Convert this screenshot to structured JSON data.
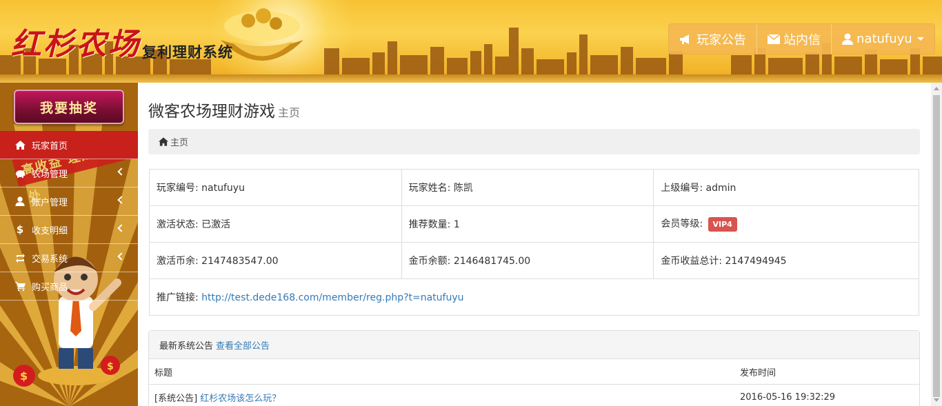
{
  "header": {
    "logo_title": "红杉农场",
    "logo_subtitle": "复利理财系统",
    "nav": [
      {
        "label": "玩家公告",
        "icon": "bullhorn-icon"
      },
      {
        "label": "站内信",
        "icon": "envelope-icon"
      },
      {
        "label": "natufuyu",
        "icon": "user-icon"
      }
    ]
  },
  "sidebar": {
    "lottery_button": "我要抽奖",
    "items": [
      {
        "label": "玩家首页",
        "icon": "home-icon",
        "active": true
      },
      {
        "label": "农场管理",
        "icon": "piggy-bank-icon"
      },
      {
        "label": "账户管理",
        "icon": "user-icon"
      },
      {
        "label": "收支明细",
        "icon": "dollar-icon"
      },
      {
        "label": "交易系统",
        "icon": "retweet-icon"
      },
      {
        "label": "购买商品",
        "icon": "shopping-cart-icon"
      }
    ],
    "banner_text": "高收益 理财好去处"
  },
  "main": {
    "title": "微客农场理财游戏",
    "subtitle": "主页",
    "breadcrumb": "主页",
    "info": {
      "player_id": "玩家编号: natufuyu",
      "player_name": "玩家姓名: 陈凯",
      "parent_id": "上级编号: admin",
      "activation_status": "激活状态: 已激活",
      "referral_count": "推荐数量: 1",
      "member_level_label": "会员等级:",
      "member_level": "VIP4",
      "activation_balance": "激活币余: 2147483547.00",
      "gold_balance": "金币余额: 2146481745.00",
      "gold_income_total": "金币收益总计: 2147494945",
      "promo_label": "推广链接:",
      "promo_link": "http://test.dede168.com/member/reg.php?t=natufuyu"
    },
    "notices": {
      "heading": "最新系统公告",
      "view_all": "查看全部公告",
      "col_title": "标题",
      "col_time": "发布时间",
      "rows": [
        {
          "tag": "[系统公告]",
          "title": "红杉农场该怎么玩？",
          "time": "2016-05-16 19:32:29"
        }
      ]
    }
  },
  "colors": {
    "header_gold": "#f7c234",
    "logo_red": "#c8141a",
    "active_menu": "#c8201a",
    "lottery_button": "#7a0e32",
    "link_blue": "#337ab7",
    "vip_badge": "#d9534f"
  }
}
